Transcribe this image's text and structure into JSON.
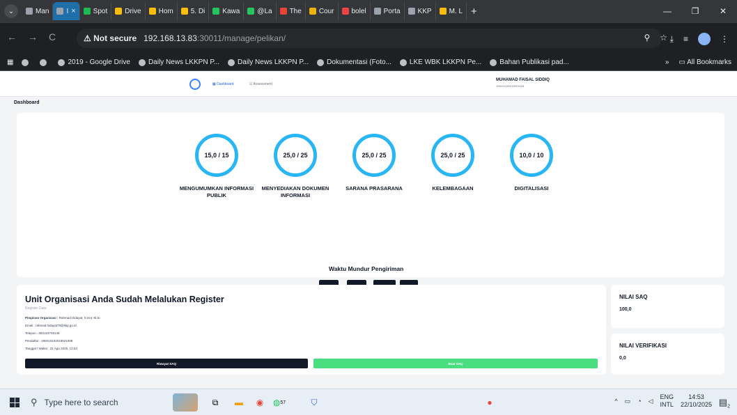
{
  "browser": {
    "tabs": [
      {
        "label": "Man",
        "color": "#9ca3af"
      },
      {
        "label": "I",
        "color": "#9ca3af",
        "active": true
      },
      {
        "label": "Spot",
        "color": "#1db954"
      },
      {
        "label": "Drive",
        "color": "#fbbc04"
      },
      {
        "label": "Hom",
        "color": "#fbbc04"
      },
      {
        "label": "5. Di",
        "color": "#fbbc04"
      },
      {
        "label": "Kawa",
        "color": "#22c55e"
      },
      {
        "label": "@La",
        "color": "#22c55e"
      },
      {
        "label": "The",
        "color": "#ea4335"
      },
      {
        "label": "Cour",
        "color": "#eab308"
      },
      {
        "label": "bolel",
        "color": "#ef4444"
      },
      {
        "label": "Porta",
        "color": "#9ca3af"
      },
      {
        "label": "KKP",
        "color": "#9ca3af"
      },
      {
        "label": "M. L",
        "color": "#fbbc04"
      }
    ],
    "tab_close": "×",
    "new_tab": "+",
    "window_controls": [
      "—",
      "❐",
      "✕"
    ],
    "nav": {
      "back": "←",
      "forward": "→",
      "reload": "C"
    },
    "security_label": "⚠ Not secure",
    "url_host": "192.168.13.83",
    "url_path": ":30011/manage/pelikan/",
    "omnibox_icons": [
      "⚲",
      "☆"
    ],
    "toolbar_icons": [
      "⤓",
      "≡"
    ],
    "bookmarks": [
      "2019 - Google Drive",
      "Daily News LKKPN P...",
      "Daily News LKKPN P...",
      "Dokumentasi (Foto...",
      "LKE WBK LKKPN Pe...",
      "Bahan Publikasi pad..."
    ],
    "bookmarks_more": "»",
    "all_bookmarks": "All Bookmarks"
  },
  "app": {
    "nav": {
      "dashboard": "Dashboard",
      "assessment": "Assessment"
    },
    "user": {
      "name": "MUHAMAD FAISAL SIDDIQ",
      "id": "198410182018021008"
    },
    "breadcrumb": "Dashboard",
    "gauges": [
      {
        "value": "15,0 / 15",
        "label": "MENGUMUMKAN INFORMASI PUBLIK"
      },
      {
        "value": "25,0 / 25",
        "label": "MENYEDIAKAN DOKUMEN INFORMASI"
      },
      {
        "value": "25,0 / 25",
        "label": "SARANA PRASARANA"
      },
      {
        "value": "25,0 / 25",
        "label": "KELEMBAGAAN"
      },
      {
        "value": "10,0 / 10",
        "label": "DIGITALISASI"
      }
    ],
    "countdown": {
      "title": "Waktu Mundur Pengiriman",
      "units": [
        {
          "value": "00",
          "unit": "Hari"
        },
        {
          "value": "00",
          "unit": "Jam"
        },
        {
          "value": "00",
          "unit": "Menit"
        },
        {
          "value": "00",
          "unit": "Detik"
        }
      ]
    },
    "register": {
      "title": "Unit Organisasi Anda Sudah Melalukan Register",
      "subtitle": "Register Data",
      "leader_label": "Pimpinan Organisasi :",
      "leader": "Rahmad Hidayat, S.Hut, M.Si",
      "email": "Email : rahmad.hidayat79@kkp.go.id",
      "phone": "Telepon : 082124745145",
      "registrant": "Pendaftar : 198410102019021008",
      "datetime": "Tanggal / Waktu : 21 Agu 2025, 13.53",
      "btn_history": "Riwayat SAQ",
      "btn_new": "Buat SAQ"
    },
    "nilai_saq": {
      "label": "NILAI SAQ",
      "value": "100,0"
    },
    "nilai_verifikasi": {
      "label": "NILAI VERIFIKASI",
      "value": "0,0"
    }
  },
  "taskbar": {
    "search_placeholder": "Type here to search",
    "badge_whatsapp": "57",
    "lang_top": "ENG",
    "lang_bottom": "INTL",
    "time": "14:53",
    "date": "22/10/2025",
    "notification_count": "2"
  }
}
